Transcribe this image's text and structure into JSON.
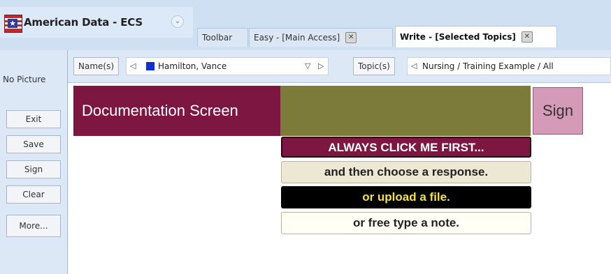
{
  "app": {
    "title": "American Data - ECS",
    "chevron": "⌄"
  },
  "tabs": [
    {
      "label": "Toolbar"
    },
    {
      "label": "Easy - [Main Access]",
      "close": "✕"
    },
    {
      "label": "Write - [Selected Topics]",
      "close": "✕",
      "active": true
    }
  ],
  "sidebar": {
    "no_picture": "No Picture",
    "buttons": [
      "Exit",
      "Save",
      "Sign",
      "Clear",
      "More..."
    ]
  },
  "selectors": {
    "names_label": "Name(s)",
    "name_value": "Hamilton, Vance",
    "name_swatch_color": "#1030d0",
    "topics_label": "Topic(s)",
    "topic_value": "Nursing / Training Example / All"
  },
  "main": {
    "banner": "Documentation Screen",
    "sign": "Sign",
    "responses": [
      "ALWAYS CLICK ME FIRST...",
      "and then choose a response.",
      "or upload a file.",
      "or free type a note."
    ]
  },
  "colors": {
    "banner": "#7d1640",
    "olive": "#7c7b3a",
    "sign": "#d59ab8",
    "upload_text": "#f6e23c"
  }
}
